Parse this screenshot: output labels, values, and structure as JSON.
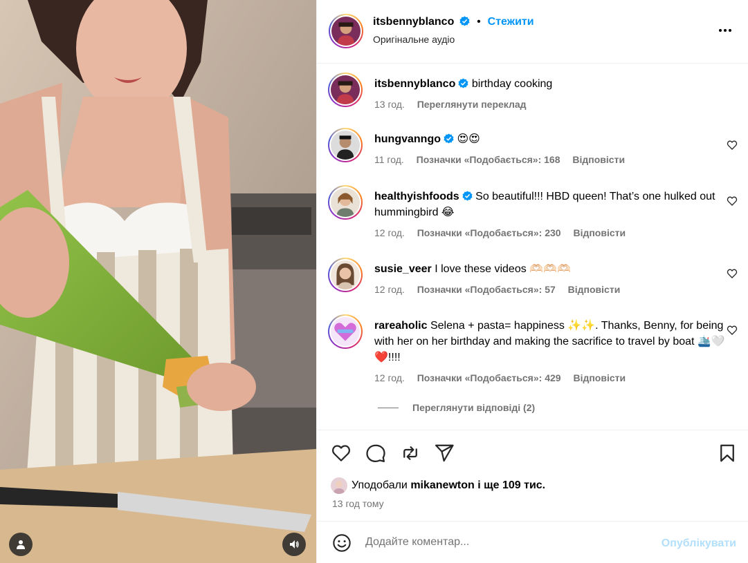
{
  "post": {
    "author": "itsbennyblanco",
    "follow_label": "Стежити",
    "separator": "•",
    "audio": "Оригінальне аудіо"
  },
  "caption": {
    "username": "itsbennyblanco",
    "text": "birthday cooking",
    "time": "13 год.",
    "translate": "Переглянути переклад"
  },
  "comments": [
    {
      "username": "hungvanngo",
      "verified": true,
      "text": "😍😍",
      "time": "11 год.",
      "likes": "Позначки «Подобається»: 168",
      "reply": "Відповісти"
    },
    {
      "username": "healthyishfoods",
      "verified": true,
      "text": "So beautiful!!! HBD queen! That’s one hulked out hummingbird 😂",
      "time": "12 год.",
      "likes": "Позначки «Подобається»: 230",
      "reply": "Відповісти"
    },
    {
      "username": "susie_veer",
      "verified": false,
      "text": "I love these videos 🫶🏻🫶🏻🫶🏻",
      "time": "12 год.",
      "likes": "Позначки «Подобається»: 57",
      "reply": "Відповісти"
    },
    {
      "username": "rareaholic",
      "verified": false,
      "text": "Selena + pasta= happiness ✨✨. Thanks, Benny, for being with her on her birthday and making the sacrifice to travel by boat 🛳️🤍❤️!!!!",
      "time": "12 год.",
      "likes": "Позначки «Подобається»: 429",
      "reply": "Відповісти"
    }
  ],
  "view_replies": "Переглянути відповіді (2)",
  "likes_summary": {
    "prefix": "Уподобали",
    "user": "mikanewton",
    "suffix": "і ще 109 тис."
  },
  "post_time": "13 год тому",
  "composer": {
    "placeholder": "Додайте коментар...",
    "publish": "Опублікувати"
  },
  "icons": {
    "verified": "verified-badge-icon",
    "more": "more-options-icon",
    "like": "heart-icon",
    "comment": "comment-icon",
    "share": "repost-icon",
    "send": "send-icon",
    "save": "bookmark-icon",
    "emoji": "emoji-icon",
    "user_tag": "user-tag-icon",
    "sound": "sound-icon"
  },
  "colors": {
    "accent": "#0095f6",
    "publish_disabled": "#b2dffc",
    "muted": "#737373",
    "verified": "#0095f6"
  }
}
